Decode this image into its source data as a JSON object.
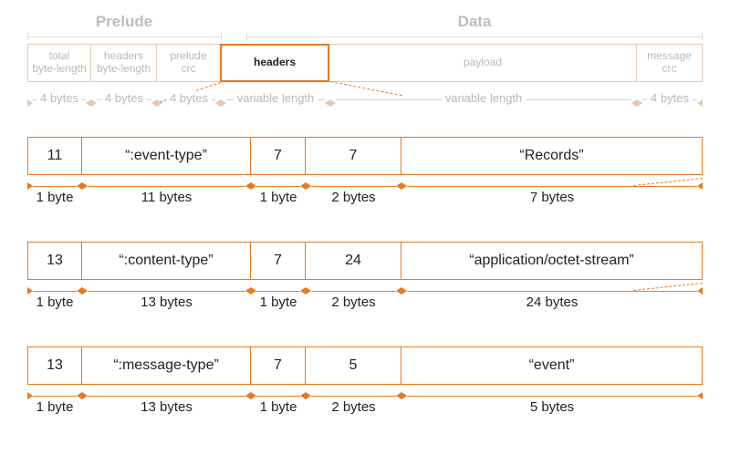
{
  "sections": {
    "prelude": "Prelude",
    "data": "Data"
  },
  "top_fields": {
    "total_len": "total\nbyte-length",
    "headers_len": "headers\nbyte-length",
    "prelude_crc": "prelude\ncrc",
    "headers": "headers",
    "payload": "payload",
    "message_crc": "message\ncrc"
  },
  "top_sizes": {
    "total_len": "4 bytes",
    "headers_len": "4 bytes",
    "prelude_crc": "4 bytes",
    "headers": "variable length",
    "payload": "variable length",
    "message_crc": "4 bytes"
  },
  "rows": [
    {
      "name_len": "11",
      "name": "“:event-type”",
      "type": "7",
      "val_len": "7",
      "value": "“Records”",
      "sizes": {
        "name_len": "1 byte",
        "name": "11 bytes",
        "type": "1 byte",
        "val_len": "2 bytes",
        "value": "7 bytes"
      }
    },
    {
      "name_len": "13",
      "name": "“:content-type”",
      "type": "7",
      "val_len": "24",
      "value": "“application/octet-stream”",
      "sizes": {
        "name_len": "1 byte",
        "name": "13 bytes",
        "type": "1 byte",
        "val_len": "2 bytes",
        "value": "24 bytes"
      }
    },
    {
      "name_len": "13",
      "name": "“:message-type”",
      "type": "7",
      "val_len": "5",
      "value": "“event”",
      "sizes": {
        "name_len": "1 byte",
        "name": "13 bytes",
        "type": "1 byte",
        "val_len": "2 bytes",
        "value": "5 bytes"
      }
    }
  ]
}
